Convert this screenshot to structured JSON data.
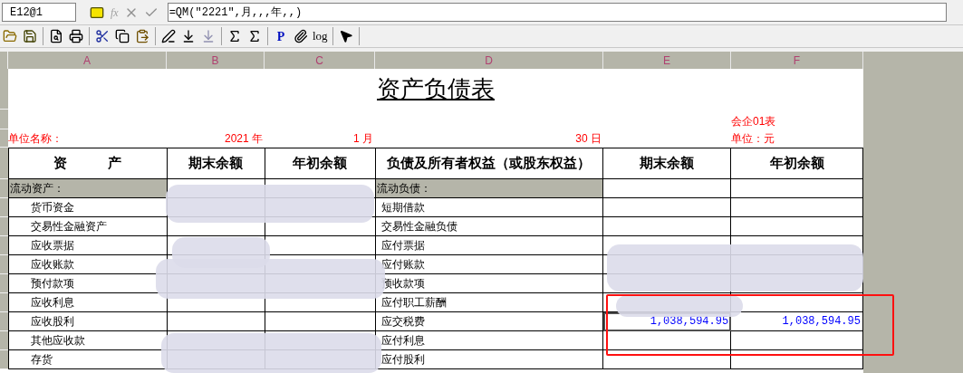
{
  "formula_bar": {
    "cell_ref": "E12@1",
    "fx": "fx",
    "formula": "=QM(″2221″,月,,,年,,)"
  },
  "toolbar_text_buttons": [
    "P",
    "log"
  ],
  "columns": [
    "A",
    "B",
    "C",
    "D",
    "E",
    "F"
  ],
  "sheet": {
    "title": "资产负债表",
    "form_no": "会企01表",
    "unit_name_label": "单位名称：",
    "year": "2021 年",
    "month": "1 月",
    "day": "30 日",
    "currency_unit": "单位：元",
    "headers": [
      "资　　　产",
      "期末余额",
      "年初余额",
      "负债及所有者权益（或股东权益）",
      "期末余额",
      "年初余额"
    ],
    "rows": [
      {
        "kind": "section",
        "asset": "流动资产：",
        "liability": "流动负债："
      },
      {
        "kind": "item",
        "asset": "货币资金",
        "liability": "短期借款"
      },
      {
        "kind": "item",
        "asset": "交易性金融资产",
        "liability": "交易性金融负债"
      },
      {
        "kind": "item",
        "asset": "应收票据",
        "liability": "应付票据"
      },
      {
        "kind": "item",
        "asset": "应收账款",
        "liability": "应付账款"
      },
      {
        "kind": "item",
        "asset": "预付款项",
        "liability": "预收款项"
      },
      {
        "kind": "item",
        "asset": "应收利息",
        "liability": "应付职工薪酬"
      },
      {
        "kind": "item",
        "asset": "应收股利",
        "liability": "应交税费",
        "end_balance": "1,038,594.95",
        "start_balance": "1,038,594.95",
        "selected": true
      },
      {
        "kind": "item",
        "asset": "其他应收款",
        "liability": "应付利息"
      },
      {
        "kind": "item",
        "asset": "存货",
        "liability": "应付股利"
      }
    ]
  }
}
